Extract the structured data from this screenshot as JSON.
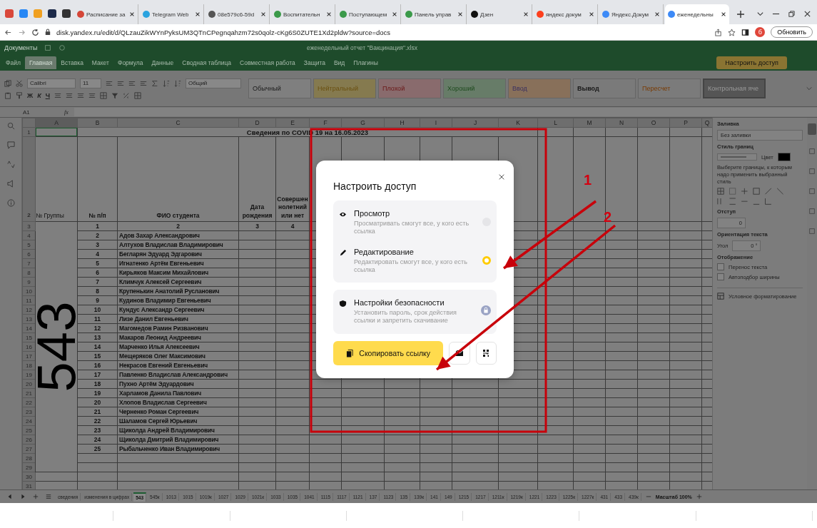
{
  "browser": {
    "pinned": [
      {
        "color": "#d9483b"
      },
      {
        "color": "#2787f5"
      },
      {
        "color": "#f0a020"
      },
      {
        "color": "#1c2a4a"
      },
      {
        "color": "#333333"
      }
    ],
    "tabs": [
      {
        "label": "Расписание за",
        "color": "#d44638",
        "selected": false
      },
      {
        "label": "Telegram Web",
        "color": "#2aa3df",
        "selected": false
      },
      {
        "label": "08e579c6-59d",
        "color": "#555555",
        "selected": false
      },
      {
        "label": "Воспитательн",
        "color": "#3b9a4a",
        "selected": false
      },
      {
        "label": "Поступающем",
        "color": "#3b9a4a",
        "selected": false
      },
      {
        "label": "Панель управ",
        "color": "#3b9a4a",
        "selected": false
      },
      {
        "label": "Дзен",
        "color": "#111111",
        "selected": false
      },
      {
        "label": "яндекс докум",
        "color": "#fc3f1d",
        "selected": false
      },
      {
        "label": "Яндекс.Докум",
        "color": "#3d8af7",
        "selected": false
      },
      {
        "label": "еженедельны",
        "color": "#3d8af7",
        "selected": true
      }
    ],
    "url": "disk.yandex.ru/edit/d/QLzauZikWYnPyksUM3QTnCPegnqahzm72s0qolz-cKg6S0ZUTE1Xd2pldw?source=docs",
    "profile": "б",
    "refresh_button": "Обновить"
  },
  "app": {
    "back": "Документы",
    "file_title": "еженедельный отчет \"Вакцинация\".xlsx",
    "share_button": "Настроить доступ",
    "menu": [
      {
        "label": "Файл",
        "selected": false
      },
      {
        "label": "Главная",
        "selected": true
      },
      {
        "label": "Вставка",
        "selected": false
      },
      {
        "label": "Макет",
        "selected": false
      },
      {
        "label": "Формула",
        "selected": false
      },
      {
        "label": "Данные",
        "selected": false
      },
      {
        "label": "Сводная таблица",
        "selected": false
      },
      {
        "label": "Совместная работа",
        "selected": false
      },
      {
        "label": "Защита",
        "selected": false
      },
      {
        "label": "Вид",
        "selected": false
      },
      {
        "label": "Плагины",
        "selected": false
      }
    ]
  },
  "toolbar": {
    "font": "Calibri",
    "size": "11",
    "number_format": "Общий",
    "text_buttons": [
      "Ж",
      "К",
      "Ч"
    ],
    "styles": [
      {
        "label": "Обычный",
        "color": "#7f7f7f"
      },
      {
        "label": "Нейтральный",
        "color": "#857a4f"
      },
      {
        "label": "Плохой",
        "color": "#896b6d"
      },
      {
        "label": "Хороший",
        "color": "#677c68"
      },
      {
        "label": "Ввод",
        "color": "#88705a"
      },
      {
        "label": "Вывод",
        "color": "#7a7a7a"
      },
      {
        "label": "Пересчет",
        "color": "#7b7b7b"
      },
      {
        "label": "Контрольная яче",
        "color": "#555555"
      }
    ]
  },
  "formula_bar": {
    "cell": "A1",
    "fx": "fx"
  },
  "sheet": {
    "columns": [
      "A",
      "B",
      "C",
      "D",
      "E",
      "F",
      "G",
      "H",
      "I",
      "J",
      "K",
      "L",
      "M",
      "N",
      "O",
      "P",
      "Q"
    ],
    "row_numbers": [
      "1",
      "2",
      "3",
      "4",
      "5",
      "6",
      "7",
      "8",
      "9",
      "10",
      "11",
      "12",
      "13",
      "14",
      "15",
      "16",
      "17",
      "18",
      "19",
      "20",
      "21",
      "22",
      "23",
      "24",
      "25",
      "26",
      "27",
      "28",
      "29",
      "30",
      "31"
    ],
    "title": "Сведения по COVID 19 на 16.05.2023",
    "headers": [
      "№ Группы",
      "№ п/п",
      "ФИО студента",
      "Дата рождения",
      "Совершеннолетний или нет"
    ],
    "numbering": [
      "1",
      "2",
      "3",
      "4"
    ],
    "group": "543",
    "rows": [
      {
        "n": "2",
        "name": "Адов Захар Александрович"
      },
      {
        "n": "3",
        "name": "Алтухов Владислав Владимирович"
      },
      {
        "n": "4",
        "name": "Бегларян Эдуард Эдгарович"
      },
      {
        "n": "5",
        "name": "Игнатенко Артём Евгеньевич"
      },
      {
        "n": "6",
        "name": "Кирьяков Максим Михайлович"
      },
      {
        "n": "7",
        "name": "Климчук Алексей Сергеевич"
      },
      {
        "n": "8",
        "name": "Крупенькин Анатолий Русланович"
      },
      {
        "n": "9",
        "name": "Кудинов Владимир Евгеньевич"
      },
      {
        "n": "10",
        "name": "Кундус Александр Сергеевич"
      },
      {
        "n": "11",
        "name": "Лизе Данил Евгеньевич"
      },
      {
        "n": "12",
        "name": "Магомедов Рамин Ризванович"
      },
      {
        "n": "13",
        "name": "Макаров Леонид Андреевич"
      },
      {
        "n": "14",
        "name": "Марченко Илья Алексеевич"
      },
      {
        "n": "15",
        "name": "Мещеряков Олег Максимович"
      },
      {
        "n": "16",
        "name": "Некрасов Евгений Евгеньевич"
      },
      {
        "n": "17",
        "name": "Павленко Владислав Александрович"
      },
      {
        "n": "18",
        "name": "Пухно Артём Эдуардович"
      },
      {
        "n": "19",
        "name": "Харламов Данила Павлович"
      },
      {
        "n": "20",
        "name": "Хлопов Владислав Сергеевич"
      },
      {
        "n": "21",
        "name": "Черненко Роман Сергеевич"
      },
      {
        "n": "22",
        "name": "Шаламов Сергей Юрьевич"
      },
      {
        "n": "23",
        "name": "Щиколда Андрей Владимирович"
      },
      {
        "n": "24",
        "name": "Щиколда Дмитрий Владимирович"
      },
      {
        "n": "25",
        "name": "Рыбальченко Иван Владимирович"
      }
    ]
  },
  "format_panel": {
    "fill_label": "Заливка",
    "fill_value": "Без заливки",
    "border_label": "Стиль границ",
    "color_label": "Цвет",
    "border_hint": "Выберите границы, к которым надо применить выбранный стиль",
    "indent_label": "Отступ",
    "indent_value": "0",
    "orientation_label": "Ориентация текста",
    "angle_label": "Угол",
    "angle_value": "0 °",
    "display_label": "Отображение",
    "checkboxes": [
      {
        "label": "Перенос текста",
        "checked": false
      },
      {
        "label": "Автоподбор ширины",
        "checked": false
      }
    ],
    "conditional": "Условное форматирование"
  },
  "sheet_tabs": [
    {
      "label": "сведения",
      "selected": false
    },
    {
      "label": "изменения в цифрах",
      "selected": false
    },
    {
      "label": "543",
      "selected": true
    },
    {
      "label": "545к",
      "selected": false
    },
    {
      "label": "1013",
      "selected": false
    },
    {
      "label": "1015",
      "selected": false
    },
    {
      "label": "1019к",
      "selected": false
    },
    {
      "label": "1027",
      "selected": false
    },
    {
      "label": "1029",
      "selected": false
    },
    {
      "label": "1021к",
      "selected": false
    },
    {
      "label": "1033",
      "selected": false
    },
    {
      "label": "1035",
      "selected": false
    },
    {
      "label": "1041",
      "selected": false
    },
    {
      "label": "1115",
      "selected": false
    },
    {
      "label": "1117",
      "selected": false
    },
    {
      "label": "1121",
      "selected": false
    },
    {
      "label": "137",
      "selected": false
    },
    {
      "label": "1123",
      "selected": false
    },
    {
      "label": "135",
      "selected": false
    },
    {
      "label": "139к",
      "selected": false
    },
    {
      "label": "141",
      "selected": false
    },
    {
      "label": "149",
      "selected": false
    },
    {
      "label": "1215",
      "selected": false
    },
    {
      "label": "1217",
      "selected": false
    },
    {
      "label": "1211к",
      "selected": false
    },
    {
      "label": "1219к",
      "selected": false
    },
    {
      "label": "1221",
      "selected": false
    },
    {
      "label": "1223",
      "selected": false
    },
    {
      "label": "1225к",
      "selected": false
    },
    {
      "label": "1227к",
      "selected": false
    },
    {
      "label": "431",
      "selected": false
    },
    {
      "label": "433",
      "selected": false
    },
    {
      "label": "439к",
      "selected": false
    }
  ],
  "zoom": "Масштаб 100%",
  "dialog": {
    "title": "Настроить доступ",
    "access": [
      {
        "kind": "view",
        "title": "Просмотр",
        "description": "Просматривать смогут все, у кого есть ссылка",
        "selected": false
      },
      {
        "kind": "edit",
        "title": "Редактирование",
        "description": "Редактировать смогут все, у кого есть ссылка",
        "selected": true
      }
    ],
    "security": {
      "title": "Настройки безопасности",
      "description": "Установить пароль, срок действия ссылки и запретить скачивание"
    },
    "copy_button": "Скопировать ссылку"
  },
  "annotations": [
    {
      "label": "1"
    },
    {
      "label": "2"
    }
  ]
}
